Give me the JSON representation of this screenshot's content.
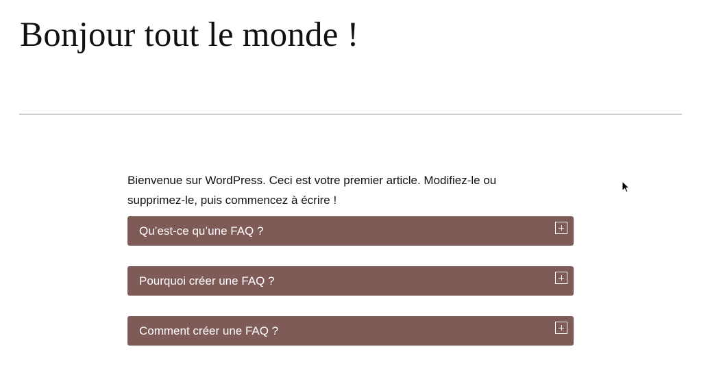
{
  "post": {
    "title": "Bonjour tout le monde !",
    "intro": "Bienvenue sur WordPress. Ceci est votre premier article. Modifiez-le ou supprimez-le, puis commencez à écrire !"
  },
  "faq": {
    "items": [
      {
        "question": "Qu’est-ce qu’une FAQ ?",
        "icon": "plus-square-icon"
      },
      {
        "question": "Pourquoi créer une FAQ ?",
        "icon": "plus-square-icon"
      },
      {
        "question": "Comment créer une FAQ ?",
        "icon": "plus-square-icon"
      }
    ]
  },
  "colors": {
    "accordion_background": "#7f5b58",
    "accordion_text": "#ffffff",
    "separator": "#cfcfcf",
    "text": "#111111"
  },
  "cursor": {
    "icon": "mouse-pointer-icon"
  }
}
